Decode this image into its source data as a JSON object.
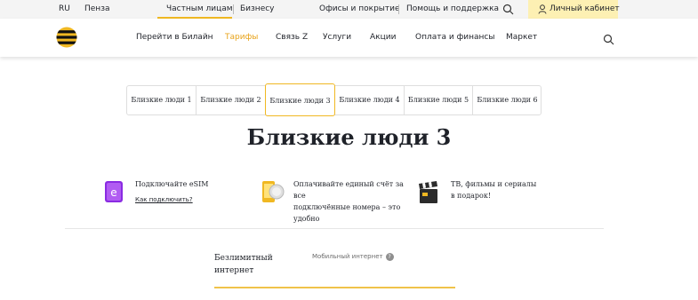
{
  "topbar": {
    "lang": "RU",
    "city": "Пенза",
    "private": "Частным лицам",
    "business": "Бизнесу",
    "offices": "Офисы и покрытие",
    "help": "Помощь и поддержка",
    "cabinet": "Личный кабинет"
  },
  "nav": {
    "items": [
      "Перейти в Билайн",
      "Тарифы",
      "Связь Z",
      "Услуги",
      "Акции",
      "Оплата и финансы",
      "Маркет"
    ],
    "active": "Тарифы"
  },
  "tabs": [
    "Близкие люди 1",
    "Близкие люди 2",
    "Близкие люди 3",
    "Близкие люди 4",
    "Близкие люди 5",
    "Близкие люди 6"
  ],
  "active_tab": "Близкие люди 3",
  "title": "Близкие люди 3",
  "features": {
    "esim": {
      "text": "Подключайте eSIM",
      "link": "Как подключить?"
    },
    "bill": {
      "line1": "Оплачивайте единый счёт за все",
      "line2": "подключённые номера – это",
      "line3": "удобно"
    },
    "tv": {
      "line1": "ТВ, фильмы и сериалы",
      "line2": "в подарок!"
    }
  },
  "plan": {
    "unlimited_line1": "Безлимитный",
    "unlimited_line2": "интернет",
    "mobile_internet": "Мобильный интернет",
    "help_mark": "?"
  },
  "colors": {
    "accent": "#f0b822",
    "accent_text": "#e8a31a",
    "cabinet_bg": "#fdf0b3",
    "esim_purple": "#8a2be2"
  }
}
